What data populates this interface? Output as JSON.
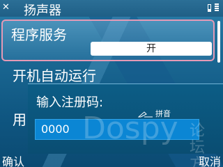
{
  "titlebar": {
    "close_icon": "close-icon",
    "title": "扬声器"
  },
  "list": {
    "items": [
      {
        "title": "程序服务",
        "value": "开"
      },
      {
        "title": "开机自动运行",
        "value": ""
      },
      {
        "title": "用",
        "value": ""
      }
    ]
  },
  "dialog": {
    "label": "输入注册码:",
    "input_mode": "拼音",
    "input_value": "0000"
  },
  "watermark": {
    "brand": "Dospy",
    "side": "论坛方"
  },
  "softkeys": {
    "left": "确认",
    "right": "取消"
  },
  "colors": {
    "accent_border": "#e59ab6",
    "input_bg": "#0b86d4",
    "titlebar_bg": "#1f5f86"
  }
}
